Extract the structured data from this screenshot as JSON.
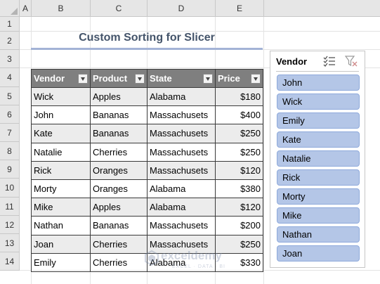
{
  "columns": [
    "A",
    "B",
    "C",
    "D",
    "E"
  ],
  "rows": [
    "1",
    "2",
    "3",
    "4",
    "5",
    "6",
    "7",
    "8",
    "9",
    "10",
    "11",
    "12",
    "13",
    "14"
  ],
  "title": "Custom Sorting for Slicer",
  "table": {
    "headers": [
      "Vendor",
      "Product",
      "State",
      "Price"
    ],
    "rows": [
      [
        "Wick",
        "Apples",
        "Alabama",
        "$180"
      ],
      [
        "John",
        "Bananas",
        "Massachusets",
        "$400"
      ],
      [
        "Kate",
        "Bananas",
        "Massachusets",
        "$250"
      ],
      [
        "Natalie",
        "Cherries",
        "Massachusets",
        "$250"
      ],
      [
        "Rick",
        "Oranges",
        "Massachusets",
        "$120"
      ],
      [
        "Morty",
        "Oranges",
        "Alabama",
        "$380"
      ],
      [
        "Mike",
        "Apples",
        "Alabama",
        "$120"
      ],
      [
        "Nathan",
        "Bananas",
        "Massachusets",
        "$200"
      ],
      [
        "Joan",
        "Cherries",
        "Massachusets",
        "$250"
      ],
      [
        "Emily",
        "Cherries",
        "Alabama",
        "$330"
      ]
    ]
  },
  "slicer": {
    "title": "Vendor",
    "icons": [
      "multi-select-icon",
      "clear-filter-icon"
    ],
    "items": [
      "John",
      "Wick",
      "Emily",
      "Kate",
      "Natalie",
      "Rick",
      "Morty",
      "Mike",
      "Nathan",
      "Joan"
    ],
    "item_color": "#b4c6e7"
  },
  "watermark": {
    "brand": "exceldemy",
    "tagline": "EXCEL · DATA · BI"
  },
  "colors": {
    "header_fill": "#7f7f7f",
    "title": "#44546a",
    "band": "#ececec"
  }
}
